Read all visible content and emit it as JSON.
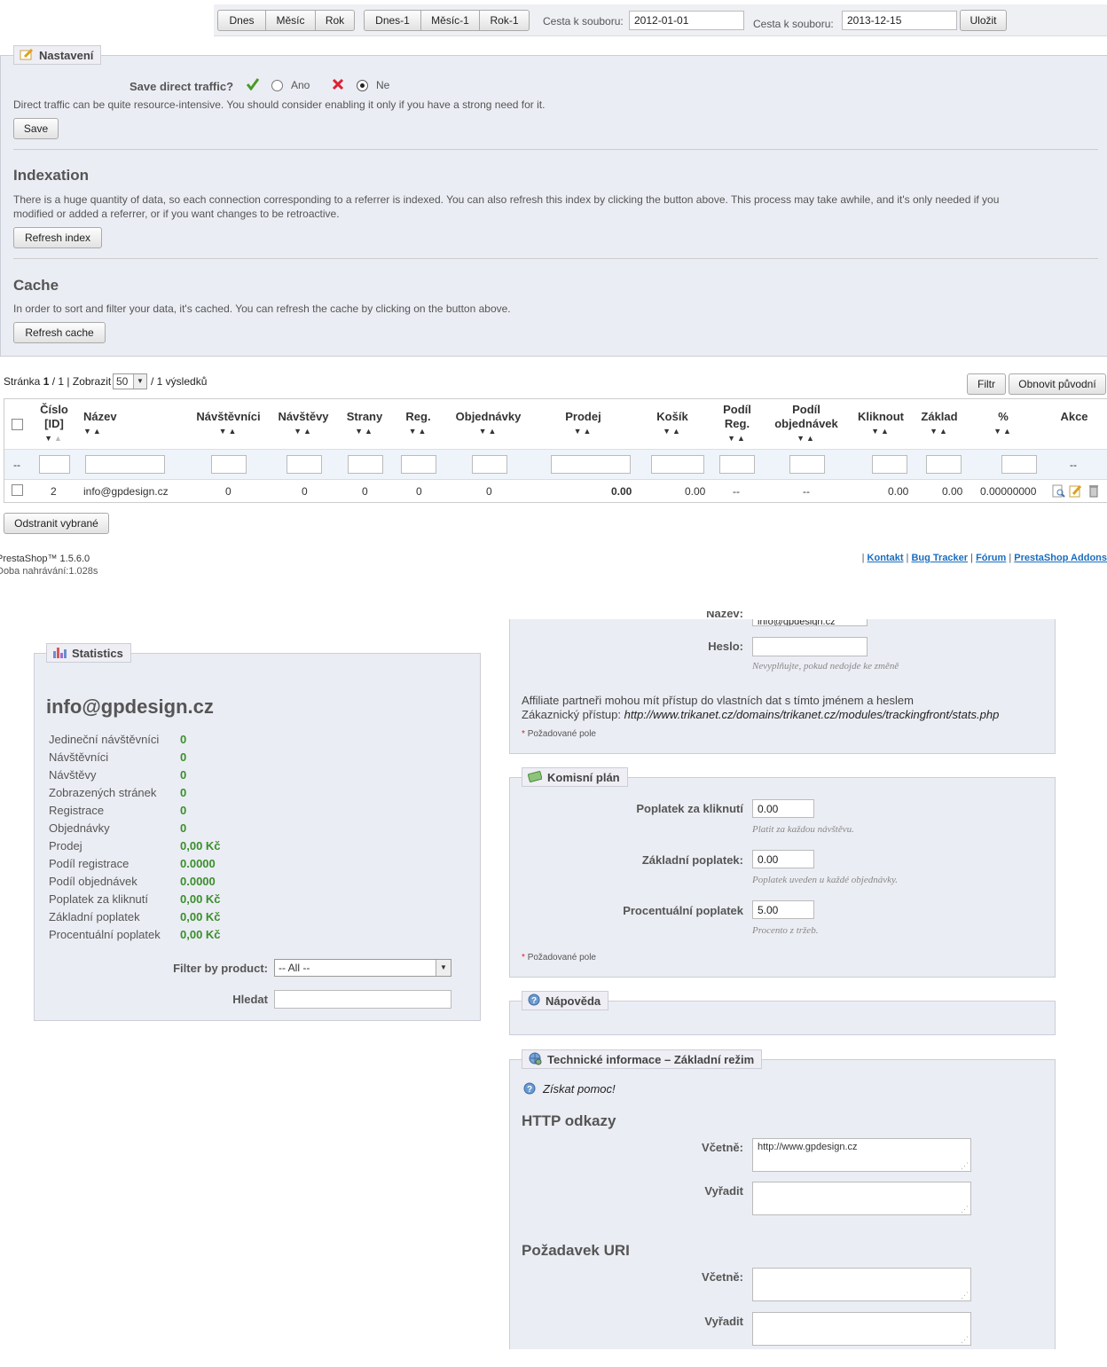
{
  "toolbar": {
    "buttons": [
      "Dnes",
      "Měsíc",
      "Rok"
    ],
    "buttons_prev": [
      "Dnes-1",
      "Měsíc-1",
      "Rok-1"
    ],
    "from_label": "Cesta k souboru:",
    "from_value": "2012-01-01",
    "to_label": "Cesta k souboru:",
    "to_value": "2013-12-15",
    "save": "Uložit"
  },
  "settings": {
    "legend": "Nastavení",
    "direct_label": "Save direct traffic?",
    "yes": "Ano",
    "no": "Ne",
    "direct_note": "Direct traffic can be quite resource-intensive. You should consider enabling it only if you have a strong need for it.",
    "save": "Save",
    "indexation_title": "Indexation",
    "indexation_text_1": "There is a huge quantity of data, so each connection corresponding to a referrer is indexed. You can also refresh this index by clicking the button above. This process may take awhile, and it's only needed if you",
    "indexation_text_2": "modified or added a referrer, or if you want changes to be retroactive.",
    "refresh_index": "Refresh index",
    "cache_title": "Cache",
    "cache_text": "In order to sort and filter your data, it's cached. You can refresh the cache by clicking on the button above.",
    "refresh_cache": "Refresh cache"
  },
  "list": {
    "page_label": "Stránka",
    "page": "1",
    "pages": "/ 1 | Zobrazit",
    "per_page": "50",
    "results": "/ 1 výsledků",
    "filter": "Filtr",
    "reset": "Obnovit původní",
    "columns": [
      "Číslo [ID]",
      "Název",
      "Návštěvníci",
      "Návštěvy",
      "Strany",
      "Reg.",
      "Objednávky",
      "Prodej",
      "Košík",
      "Podíl Reg.",
      "Podíl objednávek",
      "Kliknout",
      "Základ",
      "%",
      "Akce"
    ],
    "filter_dash": "--",
    "row": {
      "id": "2",
      "name": "info@gpdesign.cz",
      "visitors": "0",
      "visits": "0",
      "pages": "0",
      "reg": "0",
      "orders": "0",
      "sales": "0.00",
      "cart": "0.00",
      "reg_rate": "--",
      "order_rate": "--",
      "click": "0.00",
      "base": "0.00",
      "percent": "0.00000000"
    },
    "delete_selected": "Odstranit vybrané"
  },
  "footer": {
    "version": "PrestaShop™ 1.5.6.0",
    "load_time": "Doba nahrávání:1.028s",
    "links": [
      "Kontakt",
      "Bug Tracker",
      "Fórum",
      "PrestaShop Addons"
    ]
  },
  "stats": {
    "legend": "Statistics",
    "name": "info@gpdesign.cz",
    "rows": [
      {
        "label": "Jedineční návštěvníci",
        "value": "0"
      },
      {
        "label": "Návštěvníci",
        "value": "0"
      },
      {
        "label": "Návštěvy",
        "value": "0"
      },
      {
        "label": "Zobrazených stránek",
        "value": "0"
      },
      {
        "label": "Registrace",
        "value": "0"
      },
      {
        "label": "Objednávky",
        "value": "0"
      },
      {
        "label": "Prodej",
        "value": "0,00 Kč"
      },
      {
        "label": "Podíl registrace",
        "value": "0.0000"
      },
      {
        "label": "Podíl objednávek",
        "value": "0.0000"
      },
      {
        "label": "Poplatek za kliknutí",
        "value": "0,00 Kč"
      },
      {
        "label": "Základní poplatek",
        "value": "0,00 Kč"
      },
      {
        "label": "Procentuální poplatek",
        "value": "0,00 Kč"
      }
    ],
    "filter_label": "Filter by product:",
    "filter_value": "-- All --",
    "search_label": "Hledat"
  },
  "account": {
    "name_label": "Název:",
    "name_value": "info@gpdesign.cz",
    "password_label": "Heslo:",
    "password_hint": "Nevyplňujte, pokud nedojde ke změně",
    "affiliate_text": "Affiliate partneři mohou mít přístup do vlastních dat s tímto jménem a heslem",
    "customer_label": "Zákaznický přístup:",
    "customer_url": "http://www.trikanet.cz/domains/trikanet.cz/modules/trackingfront/stats.php",
    "required": "Požadované pole"
  },
  "commission": {
    "legend": "Komisní plán",
    "click_label": "Poplatek za kliknutí",
    "click_value": "0.00",
    "click_hint": "Platit za každou návštěvu.",
    "base_label": "Základní poplatek:",
    "base_value": "0.00",
    "base_hint": "Poplatek uveden u každé objednávky.",
    "percent_label": "Procentuální poplatek",
    "percent_value": "5.00",
    "percent_hint": "Procento z tržeb.",
    "required": "Požadované pole"
  },
  "help": {
    "legend": "Nápověda"
  },
  "tech": {
    "legend": "Technické informace – Základní režim",
    "help_link": "Získat pomoc!",
    "http_title": "HTTP odkazy",
    "include_label": "Včetně:",
    "include_value": "http://www.gpdesign.cz",
    "exclude_label": "Vyřadit",
    "uri_title": "Požadavek URI",
    "uri_include_label": "Včetně:",
    "uri_exclude_label": "Vyřadit"
  }
}
